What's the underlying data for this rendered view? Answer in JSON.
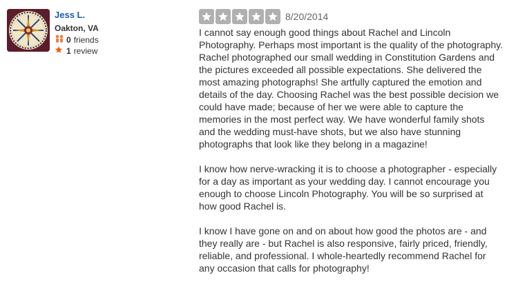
{
  "user": {
    "name": "Jess L.",
    "location": "Oakton, VA",
    "friends_count": "0",
    "friends_label": "friends",
    "reviews_count": "1",
    "reviews_label": "review"
  },
  "review": {
    "rating": 5,
    "rating_max": 5,
    "date": "8/20/2014",
    "paragraphs": [
      "I cannot say enough good things about Rachel and Lincoln Photography.  Perhaps most important is the quality of the photography.  Rachel photographed our small wedding in Constitution Gardens and the pictures exceeded all possible expectations.  She delivered the most amazing photographs!  She artfully captured the emotion and details of the day.  Choosing Rachel was the best possible decision we could have made; because of her we were able to capture the memories in the most perfect way.  We have wonderful family shots and the wedding must-have shots, but we also have stunning photographs that look like they belong in a magazine!",
      "I know how nerve-wracking it is to choose a photographer - especially for a day as important as your wedding day.  I cannot encourage you enough to choose Lincoln Photography.  You will be so surprised at how good Rachel is.",
      "I know I have gone on and on about how good the photos are - and they really are - but Rachel is also responsive, fairly priced, friendly, reliable, and professional. I whole-heartedly recommend Rachel for any occasion that calls for photography!"
    ]
  },
  "colors": {
    "username": "#1a5ab6",
    "star_bg": "#b0b0b0",
    "friends_icon": "#f07c3e",
    "review_icon": "#f15c00"
  },
  "icons": {
    "friends": "friends-icon",
    "review": "star-icon"
  }
}
